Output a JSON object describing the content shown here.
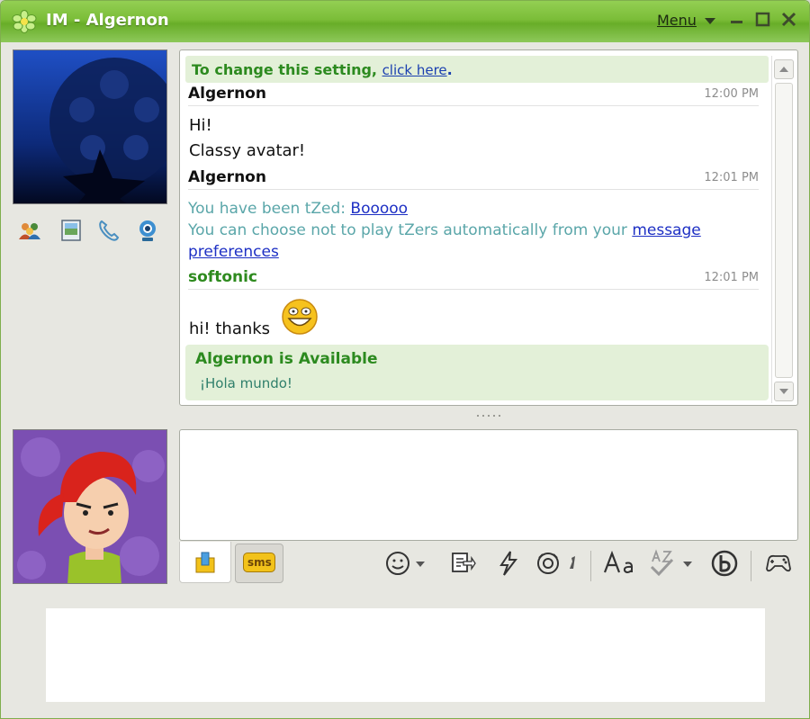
{
  "window": {
    "title": "IM - Algernon",
    "menu_label": "Menu",
    "brand_color": "#7bbd38"
  },
  "notice": {
    "text": "To change this setting,",
    "link": "click here",
    "end": "."
  },
  "messages": [
    {
      "name": "Algernon",
      "time": "12:00 PM",
      "lines": [
        "Hi!",
        "Classy avatar!"
      ]
    },
    {
      "name": "Algernon",
      "time": "12:01 PM",
      "tzed_prefix": "You have been tZed:",
      "tzed_link": "Booooo",
      "tzed_line2": "You can choose not to play tZers automatically from your",
      "tzed_link2a": "message",
      "tzed_link2b": "preferences"
    },
    {
      "name": "softonic",
      "time": "12:01 PM",
      "lines": [
        "hi! thanks"
      ]
    }
  ],
  "status": {
    "title": "Algernon is Available",
    "message": "¡Hola mundo!"
  },
  "toolbar": {
    "sms_label": "sms"
  }
}
